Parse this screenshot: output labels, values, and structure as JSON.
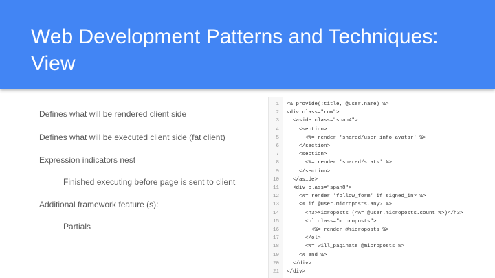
{
  "slide": {
    "title_line1": "Web Development Patterns and Techniques:",
    "title_line2": "View"
  },
  "bullets": [
    {
      "text": "Defines what will be rendered client side",
      "level": 1
    },
    {
      "text": "Defines what will be executed client side (fat client)",
      "level": 1
    },
    {
      "text": "Expression indicators nest",
      "level": 1
    },
    {
      "text": "Finished executing before page is sent to client",
      "level": 2
    },
    {
      "text": "Additional framework feature (s):",
      "level": 1
    },
    {
      "text": "Partials",
      "level": 2
    }
  ],
  "code": {
    "lines": [
      {
        "num": "1",
        "text": "<% provide(:title, @user.name) %>"
      },
      {
        "num": "2",
        "text": "<div class=\"row\">"
      },
      {
        "num": "3",
        "text": "  <aside class=\"span4\">"
      },
      {
        "num": "4",
        "text": "    <section>"
      },
      {
        "num": "5",
        "text": "      <%= render 'shared/user_info_avatar' %>"
      },
      {
        "num": "6",
        "text": "    </section>"
      },
      {
        "num": "7",
        "text": "    <section>"
      },
      {
        "num": "8",
        "text": "      <%= render 'shared/stats' %>"
      },
      {
        "num": "9",
        "text": "    </section>"
      },
      {
        "num": "10",
        "text": "  </aside>"
      },
      {
        "num": "11",
        "text": "  <div class=\"span8\">"
      },
      {
        "num": "12",
        "text": "    <%= render 'follow_form' if signed_in? %>"
      },
      {
        "num": "13",
        "text": "    <% if @user.microposts.any? %>"
      },
      {
        "num": "14",
        "text": "      <h3>Microposts (<%= @user.microposts.count %>)</h3>"
      },
      {
        "num": "15",
        "text": "      <ol class=\"microposts\">"
      },
      {
        "num": "16",
        "text": "        <%= render @microposts %>"
      },
      {
        "num": "17",
        "text": "      </ol>"
      },
      {
        "num": "18",
        "text": "      <%= will_paginate @microposts %>"
      },
      {
        "num": "19",
        "text": "    <% end %>"
      },
      {
        "num": "20",
        "text": "  </div>"
      },
      {
        "num": "21",
        "text": "</div>"
      }
    ]
  }
}
